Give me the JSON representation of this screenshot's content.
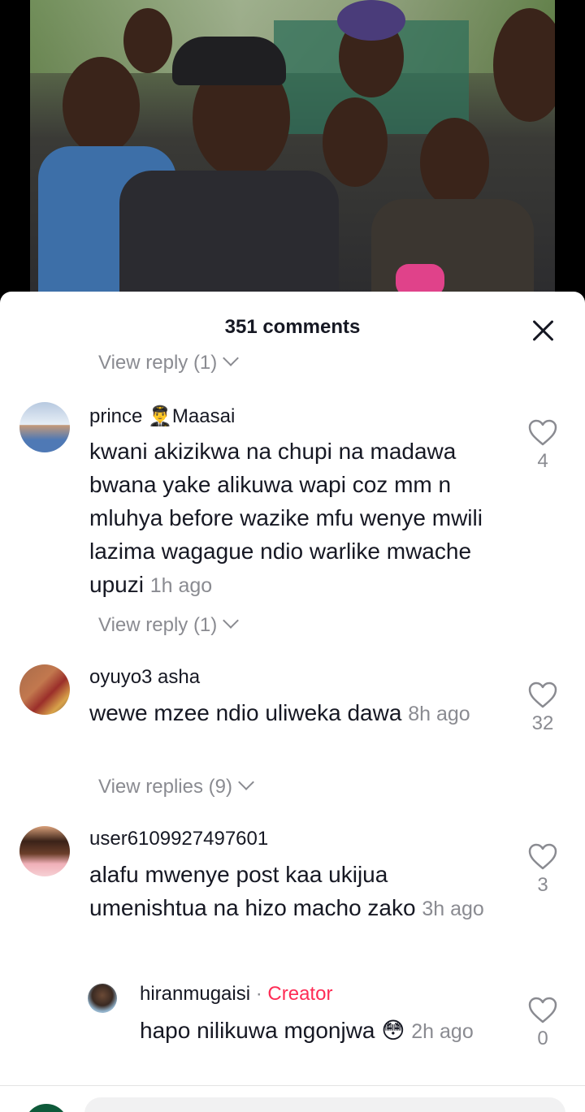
{
  "sheet": {
    "title": "351 comments",
    "close_icon": "close-icon"
  },
  "top_view_reply": "View reply (1)",
  "comments": [
    {
      "username": "prince 👨‍✈️Maasai",
      "text": "kwani akizikwa na chupi na madawa bwana yake alikuwa wapi coz mm n mluhya before wazike mfu wenye mwili lazima wagague ndio warlike mwache upuzi",
      "time": "1h ago",
      "likes": "4",
      "replies_label": "View reply (1)"
    },
    {
      "username": "oyuyo3 asha",
      "text": "wewe mzee ndio uliweka dawa",
      "time": "8h ago",
      "likes": "32",
      "replies_label": "View replies (9)"
    },
    {
      "username": "user6109927497601",
      "text": "alafu mwenye post kaa ukijua umenishtua na hizo macho zako",
      "time": "3h ago",
      "likes": "3"
    }
  ],
  "reply": {
    "username": "hiranmugaisi",
    "separator": " · ",
    "badge": "Creator",
    "text": "hapo nilikuwa mgonjwa 😳",
    "time": "2h ago",
    "likes": "0"
  },
  "colors": {
    "accent": "#fe2c55",
    "muted": "#8a8b91",
    "text": "#161823"
  }
}
